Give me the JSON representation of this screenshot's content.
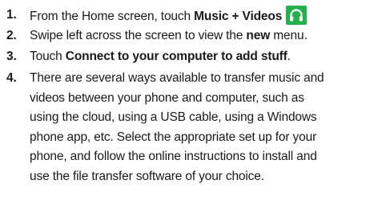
{
  "steps": [
    {
      "number": "1.",
      "pre": "From the Home screen, touch ",
      "bold": "Music + Videos",
      "icon": "headphones-icon",
      "icon_color": "#22b24c"
    },
    {
      "number": "2.",
      "pre": "Swipe left across the screen to view the ",
      "bold": "new",
      "post": " menu."
    },
    {
      "number": "3.",
      "pre": "Touch ",
      "bold": "Connect to your computer to add stuff",
      "post": "."
    },
    {
      "number": "4.",
      "lines": [
        "There are several ways available to transfer music and",
        "videos between your phone and computer, such as",
        "using the cloud, using a USB cable, using a Windows",
        "phone app, etc. Select the appropriate set up for your",
        "phone, and follow the online instructions to install and",
        "use the file transfer software of your choice."
      ]
    }
  ]
}
